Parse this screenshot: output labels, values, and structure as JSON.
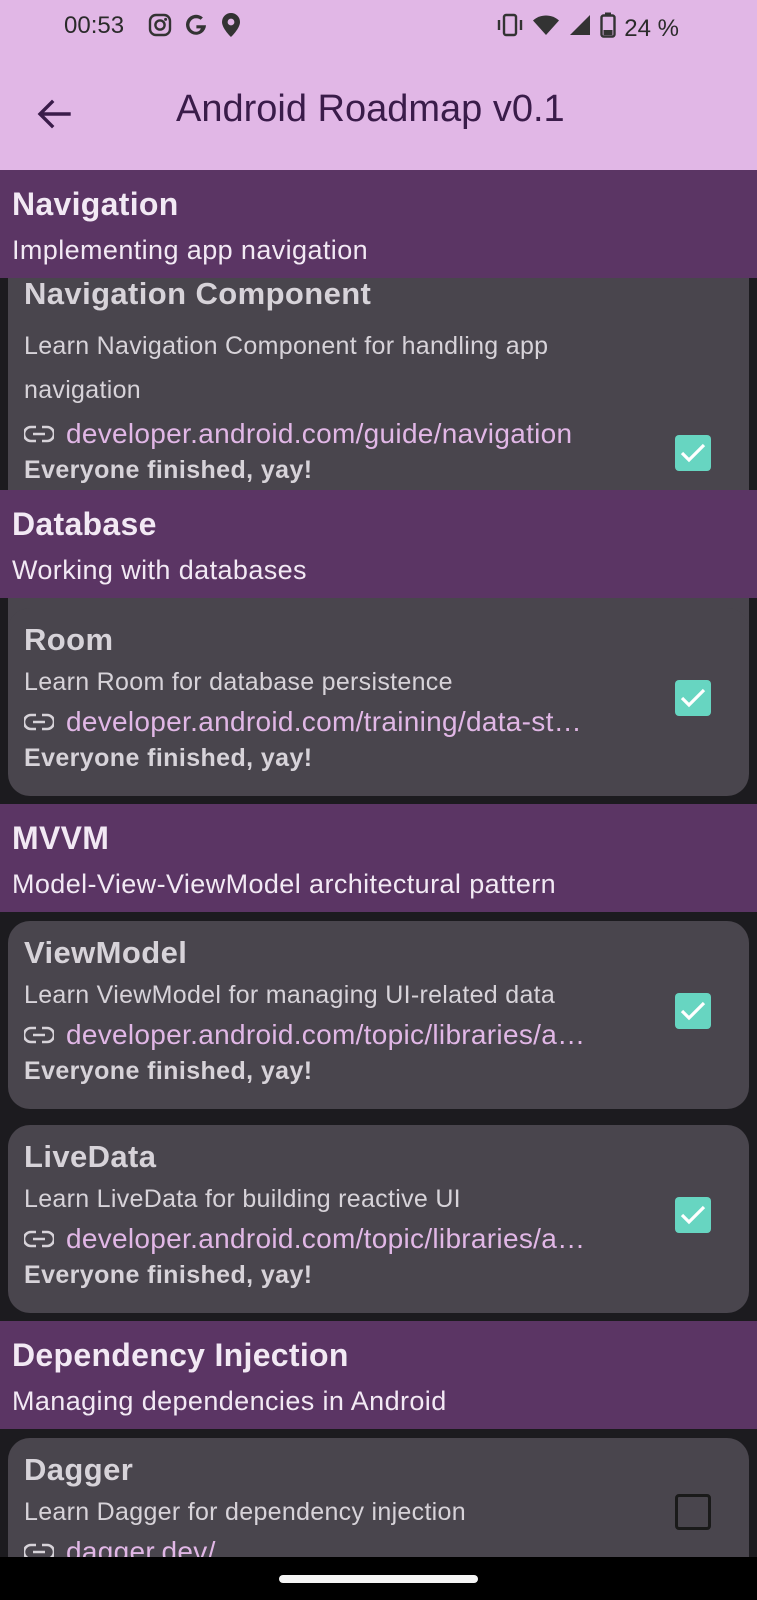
{
  "status": {
    "time": "00:53",
    "battery": "24 %"
  },
  "appbar": {
    "title": "Android Roadmap v0.1"
  },
  "sections": [
    {
      "title": "Navigation",
      "subtitle": "Implementing app navigation"
    },
    {
      "title": "Database",
      "subtitle": "Working with databases"
    },
    {
      "title": "MVVM",
      "subtitle": "Model-View-ViewModel architectural pattern"
    },
    {
      "title": "Dependency Injection",
      "subtitle": "Managing dependencies in Android"
    }
  ],
  "cards": [
    {
      "title": "Navigation Component",
      "desc": "Learn Navigation Component for handling app navigation",
      "link": "developer.android.com/guide/navigation",
      "status": "Everyone finished, yay!",
      "checked": true
    },
    {
      "title": "Room",
      "desc": "Learn Room for database persistence",
      "link": "developer.android.com/training/data-st…",
      "status": "Everyone finished, yay!",
      "checked": true
    },
    {
      "title": "ViewModel",
      "desc": "Learn ViewModel for managing UI-related data",
      "link": "developer.android.com/topic/libraries/a…",
      "status": "Everyone finished, yay!",
      "checked": true
    },
    {
      "title": "LiveData",
      "desc": "Learn LiveData for building reactive UI",
      "link": "developer.android.com/topic/libraries/a…",
      "status": "Everyone finished, yay!",
      "checked": true
    },
    {
      "title": "Dagger",
      "desc": "Learn Dagger for dependency injection",
      "link": "dagger.dev/",
      "status": "",
      "checked": false
    }
  ],
  "colors": {
    "appbar": "#e1b7e6",
    "section": "#5b3564",
    "card": "#49454d",
    "check": "#67d5c1",
    "link": "#e1b7e6"
  },
  "icons": [
    "instagram-icon",
    "google-icon",
    "location-icon",
    "vibrate-icon",
    "wifi-icon",
    "signal-icon",
    "battery-icon",
    "back-arrow-icon",
    "link-icon",
    "check-icon"
  ]
}
